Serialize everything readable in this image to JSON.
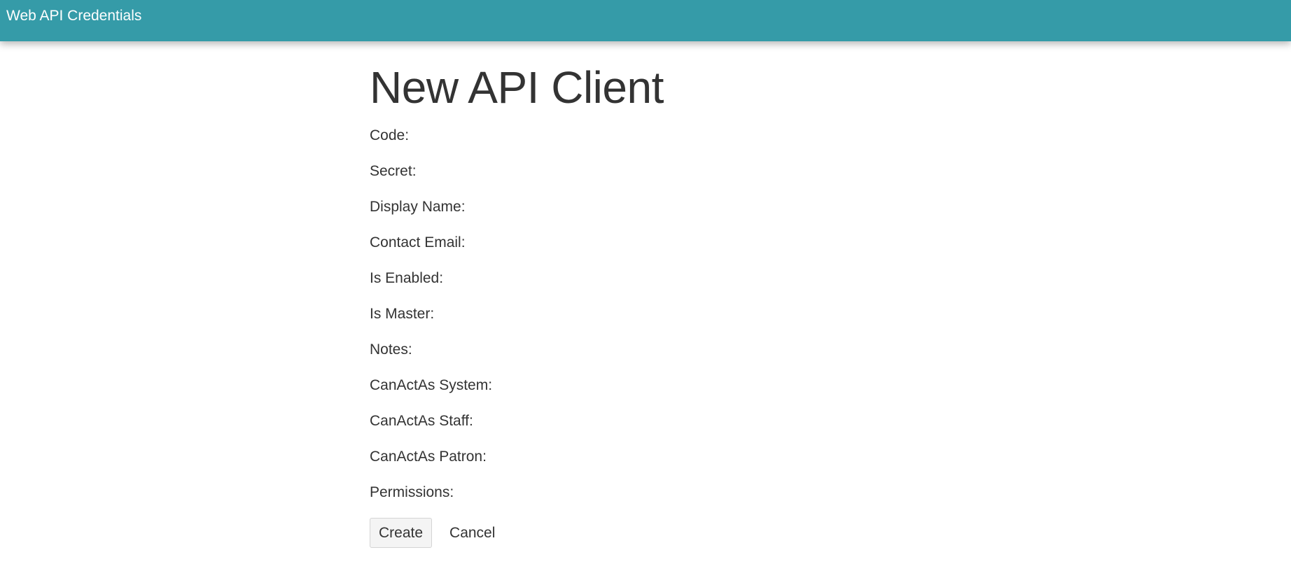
{
  "header": {
    "app_title": "Web API Credentials",
    "bar_color": "#359ba8"
  },
  "main": {
    "page_title": "New API Client",
    "fields": [
      {
        "label": "Code:"
      },
      {
        "label": "Secret:"
      },
      {
        "label": "Display Name:"
      },
      {
        "label": "Contact Email:"
      },
      {
        "label": "Is Enabled:"
      },
      {
        "label": "Is Master:"
      },
      {
        "label": "Notes:"
      },
      {
        "label": "CanActAs System:"
      },
      {
        "label": "CanActAs Staff:"
      },
      {
        "label": "CanActAs Patron:"
      },
      {
        "label": "Permissions:"
      }
    ],
    "actions": {
      "create_label": "Create",
      "cancel_label": "Cancel"
    }
  }
}
